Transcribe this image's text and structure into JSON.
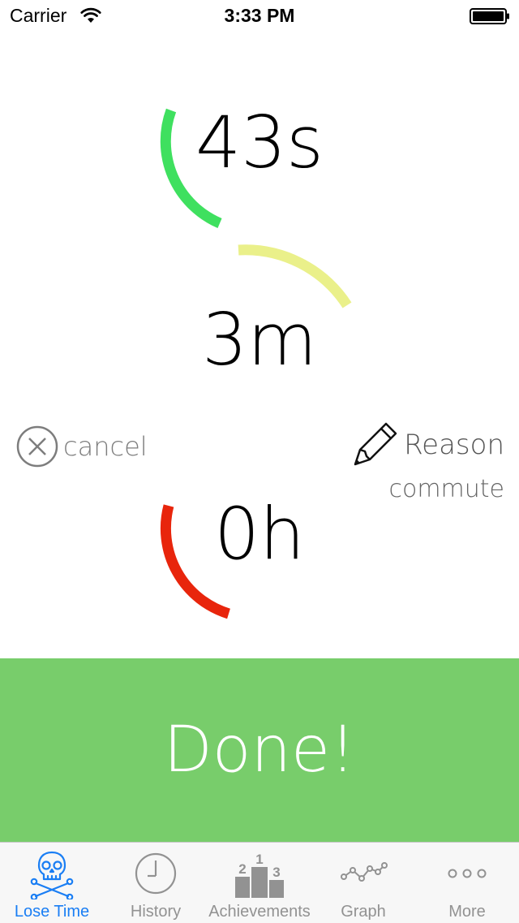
{
  "status_bar": {
    "carrier": "Carrier",
    "time": "3:33 PM"
  },
  "timer": {
    "seconds": "43s",
    "minutes": "3m",
    "hours": "0h",
    "seconds_color": "#3fe05f",
    "minutes_color": "#eaf08a",
    "hours_color": "#e8250c"
  },
  "actions": {
    "cancel_label": "cancel",
    "reason_label": "Reason",
    "reason_value": "commute"
  },
  "done_button": {
    "label": "Done!",
    "color": "#78cd6b"
  },
  "tab_bar": {
    "active_color": "#1a7ef4",
    "inactive_color": "#929292",
    "tabs": [
      {
        "label": "Lose Time",
        "icon": "skull-crossbones-icon",
        "active": true
      },
      {
        "label": "History",
        "icon": "clock-icon",
        "active": false
      },
      {
        "label": "Achievements",
        "icon": "podium-icon",
        "active": false
      },
      {
        "label": "Graph",
        "icon": "line-graph-icon",
        "active": false
      },
      {
        "label": "More",
        "icon": "more-dots-icon",
        "active": false
      }
    ]
  }
}
